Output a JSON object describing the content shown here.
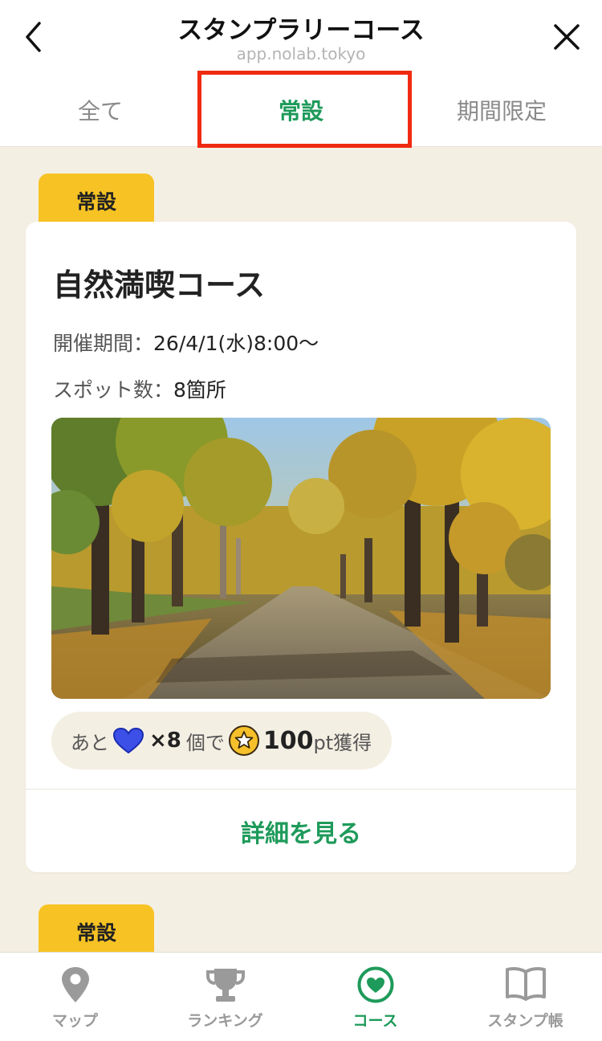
{
  "header": {
    "title": "スタンプラリーコース",
    "url": "app.nolab.tokyo"
  },
  "tabs": [
    {
      "label": "全て",
      "active": false
    },
    {
      "label": "常設",
      "active": true
    },
    {
      "label": "期間限定",
      "active": false
    }
  ],
  "courses": [
    {
      "badge": "常設",
      "title": "自然満喫コース",
      "period_label": "開催期間：",
      "period_value": "26/4/1(水)8:00〜",
      "spots_label": "スポット数：",
      "spots_value": "8箇所",
      "reward": {
        "prefix": "あと",
        "count": "×8",
        "unit": "個で",
        "points": "100",
        "suffix": "pt獲得"
      },
      "detail_label": "詳細を見る"
    },
    {
      "badge": "常設"
    }
  ],
  "bottom_nav": [
    {
      "label": "マップ",
      "icon": "map-pin-icon",
      "active": false
    },
    {
      "label": "ランキング",
      "icon": "trophy-icon",
      "active": false
    },
    {
      "label": "コース",
      "icon": "heart-circle-icon",
      "active": true
    },
    {
      "label": "スタンプ帳",
      "icon": "book-icon",
      "active": false
    }
  ],
  "colors": {
    "accent_green": "#1e9a5a",
    "badge_yellow": "#f7c324",
    "highlight_red": "#f02a10",
    "background": "#f4efe3",
    "heart_blue": "#3c50e8"
  }
}
